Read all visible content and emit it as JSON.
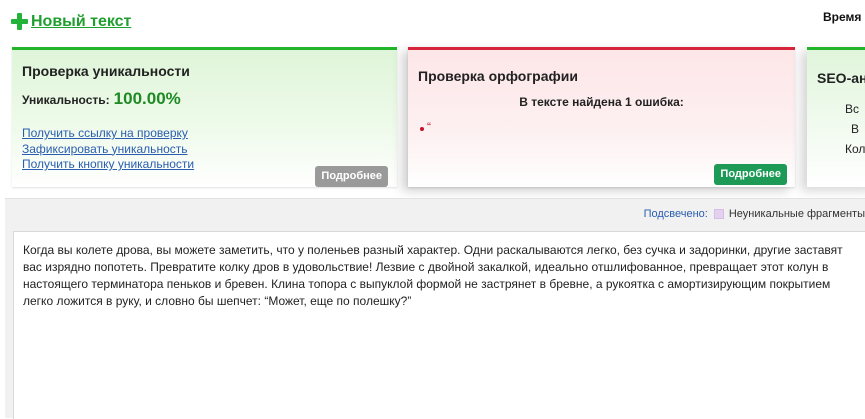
{
  "header": {
    "new_text_label": "Новый текст",
    "time_label": "Время"
  },
  "uniqueness": {
    "title": "Проверка уникальности",
    "label": "Уникальность:",
    "value": "100.00%",
    "links": [
      "Получить ссылку на проверку",
      "Зафиксировать уникальность",
      "Получить кнопку уникальности"
    ],
    "more_label": "Подробнее"
  },
  "spelling": {
    "title": "Проверка орфографии",
    "found_text": "В тексте найдена 1 ошибка:",
    "errors": [
      "“"
    ],
    "more_label": "Подробнее"
  },
  "seo": {
    "title": "SEO-ан",
    "lines": [
      "Вс",
      "В",
      "Кол"
    ]
  },
  "highlight": {
    "label": "Подсвечено:",
    "legend": "Неуникальные фрагменты"
  },
  "text": {
    "content": "Когда вы колете дрова, вы можете заметить, что у поленьев разный характер. Одни раскалываются легко, без сучка и задоринки, другие заставят вас изрядно попотеть. Превратите колку дров в удовольствие! Лезвие с двойной закалкой, идеально отшлифованное, превращает этот колун в настоящего терминатора пеньков и бревен. Клина топора с выпуклой формой не застрянет в бревне, а рукоятка с амортизирующим покрытием легко ложится в руку, и словно бы шепчет: “Может, еще по полешку?”"
  },
  "colors": {
    "green_accent": "#22b52a",
    "red_accent": "#d8243a",
    "link_blue": "#2a5db0"
  }
}
